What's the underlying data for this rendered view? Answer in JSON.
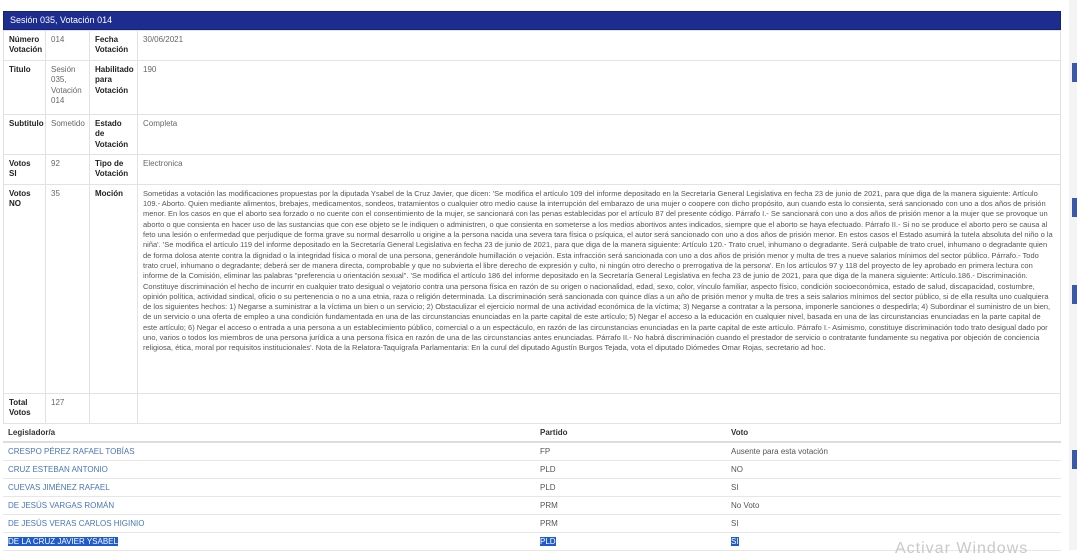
{
  "panel": {
    "title": "Sesión 035, Votación 014"
  },
  "info": {
    "numero_label": "Número Votación",
    "numero_value": "014",
    "fecha_label": "Fecha Votación",
    "fecha_value": "30/06/2021",
    "titulo_label": "Titulo",
    "titulo_value": "Sesión 035, Votación 014",
    "habilitado_label": "Habilitado para Votación",
    "habilitado_value": "190",
    "subtitulo_label": "Subtitulo",
    "subtitulo_value": "Sometido",
    "estado_label": "Estado de Votación",
    "estado_value": "Completa",
    "votos_si_label": "Votos SI",
    "votos_si_value": "92",
    "tipo_label": "Tipo de Votación",
    "tipo_value": "Electronica",
    "votos_no_label": "Votos NO",
    "votos_no_value": "35",
    "mocion_label": "Moción",
    "mocion_value": "Sometidas a votación las modificaciones propuestas por la diputada Ysabel de la Cruz Javier, que dicen: 'Se modifica el artículo 109 del informe depositado en la Secretaría General Legislativa en fecha 23 de junio de 2021, para que diga de la manera siguiente: Artículo 109.- Aborto. Quien mediante alimentos, brebajes, medicamentos, sondeos, tratamientos o cualquier otro medio cause la interrupción del embarazo de una mujer o coopere con dicho propósito, aun cuando esta lo consienta, será sancionado con uno a dos años de prisión menor. En los casos en que el aborto sea forzado o no cuente con el consentimiento de la mujer, se sancionará con las penas establecidas por el artículo 87 del presente código. Párrafo I.- Se sancionará con uno a dos años de prisión menor a la mujer que se provoque un aborto o que consienta en hacer uso de las sustancias que con ese objeto se le indiquen o administren, o que consienta en someterse a los medios abortivos antes indicados, siempre que el aborto se haya efectuado. Párrafo II.- Si no se produce el aborto pero se causa al feto una lesión o enfermedad que perjudique de forma grave su normal desarrollo u origine a la persona nacida una severa tara física o psíquica, el autor será sancionado con uno a dos años de prisión menor. En estos casos el Estado asumirá la tutela absoluta del niño o la niña'. 'Se modifica el artículo 119 del informe depositado en la Secretaría General Legislativa en fecha 23 de junio de 2021, para que diga de la manera siguiente: Artículo 120.- Trato cruel, inhumano o degradante. Será culpable de trato cruel, inhumano o degradante quien de forma dolosa atente contra la dignidad o la integridad física o moral de una persona, generándole humillación o vejación. Esta infracción será sancionada con uno a dos años de prisión menor y multa de tres a nueve salarios mínimos del sector público. Párrafo.- Todo trato cruel, inhumano o degradante; deberá ser de manera directa, comprobable y que no subvierta el libre derecho de expresión y culto, ni ningún otro derecho o prerrogativa de la persona'. En los artículos 97 y 118 del proyecto de ley aprobado en primera lectura con informe de la Comisión, eliminar las palabras \"preferencia u orientación sexual\". 'Se modifica el artículo 186 del informe depositado en la Secretaría General Legislativa en fecha 23 de junio de 2021, para que diga de la manera siguiente: Artículo.186.- Discriminación. Constituye discriminación el hecho de incurrir en cualquier trato desigual o vejatorio contra una persona física en razón de su origen o nacionalidad, edad, sexo, color, vínculo familiar, aspecto físico, condición socioeconómica, estado de salud, discapacidad, costumbre, opinión política, actividad sindical, oficio o su pertenencia o no a una etnia, raza o religión determinada. La discriminación será sancionada con quince días a un año de prisión menor y multa de tres a seis salarios mínimos del sector público, si de ella resulta uno cualquiera de los siguientes hechos: 1) Negarse a suministrar a la víctima un bien o un servicio; 2) Obstaculizar el ejercicio normal de una actividad económica de la víctima; 3) Negarse a contratar a la persona, imponerle sanciones o despedirla; 4) Subordinar el suministro de un bien, de un servicio o una oferta de empleo a una condición fundamentada en una de las circunstancias enunciadas en la parte capital de este artículo; 5) Negar el acceso a la educación en cualquier nivel, basada en una de las circunstancias enunciadas en la parte capital de este artículo; 6) Negar el acceso o entrada a una persona a un establecimiento público, comercial o a un espectáculo, en razón de las circunstancias enunciadas en la parte capital de este artículo. Párrafo I.- Asimismo, constituye discriminación todo trato desigual dado por uno, varios o todos los miembros de una persona jurídica a una persona física en razón de una de las circunstancias antes enunciadas. Párrafo II.- No habrá discriminación cuando el prestador de servicio o contratante fundamente su negativa por objeción de conciencia religiosa, ética, moral por requisitos institucionales'. Nota de la Relatora-Taquígrafa Parlamentaria: En la curul del diputado Agustín Burgos Tejada, vota el diputado Diómedes Omar Rojas, secretario ad hoc.",
    "total_label": "Total Votos",
    "total_value": "127"
  },
  "votes": {
    "headers": [
      "Legislador/a",
      "Partido",
      "Voto"
    ],
    "rows": [
      {
        "legislador": "CRESPO PÉREZ RAFAEL TOBÍAS",
        "partido": "FP",
        "voto": "Ausente para esta votación"
      },
      {
        "legislador": "CRUZ ESTEBAN ANTONIO",
        "partido": "PLD",
        "voto": "NO"
      },
      {
        "legislador": "CUEVAS JIMÉNEZ RAFAEL",
        "partido": "PLD",
        "voto": "SI"
      },
      {
        "legislador": "DE JESÚS VARGAS ROMÁN",
        "partido": "PRM",
        "voto": "No Voto"
      },
      {
        "legislador": "DE JESÚS VERAS CARLOS HIGINIO",
        "partido": "PRM",
        "voto": "SI"
      },
      {
        "legislador": "DE LA CRUZ JAVIER YSABEL",
        "partido": "PLD",
        "voto": "SI"
      }
    ]
  },
  "watermark": "Activar Windows"
}
